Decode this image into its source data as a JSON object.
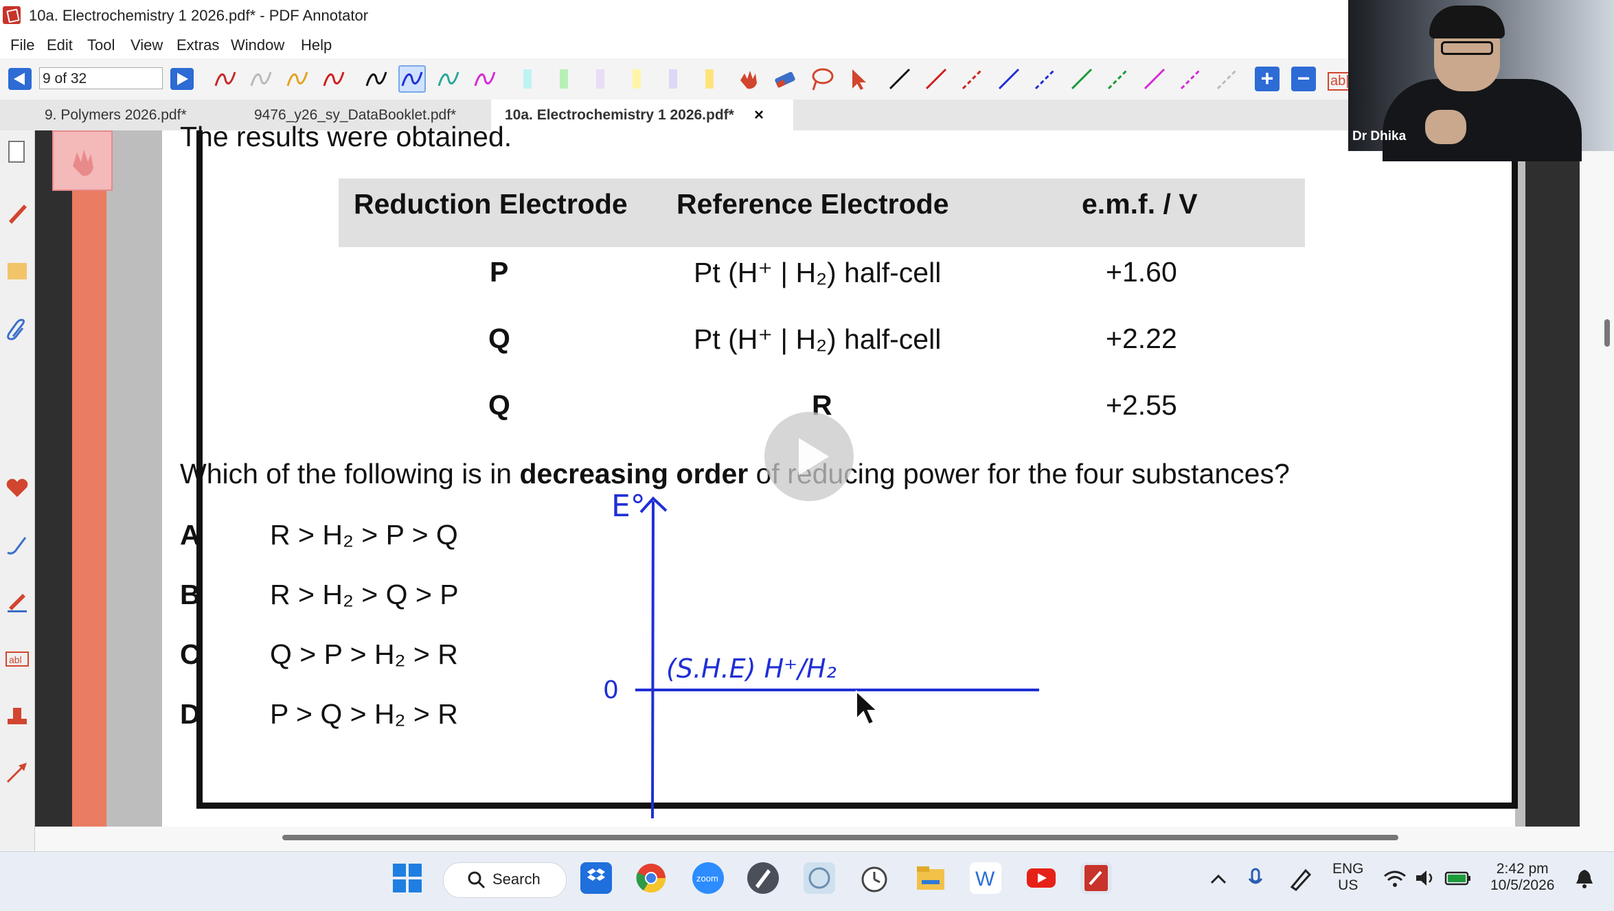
{
  "window": {
    "title": "10a. Electrochemistry 1 2026.pdf* - PDF Annotator"
  },
  "menu": [
    "File",
    "Edit",
    "Tool",
    "View",
    "Extras",
    "Window",
    "Help"
  ],
  "toolbar": {
    "page_indicator": "9 of 32",
    "text_tool_label": "ab|"
  },
  "tabs": [
    {
      "label": "9. Polymers 2026.pdf*"
    },
    {
      "label": "9476_y26_sy_DataBooklet.pdf*"
    },
    {
      "label": "10a. Electrochemistry 1 2026.pdf*",
      "active": true
    }
  ],
  "tab_close": "×",
  "document": {
    "intro": "The results were obtained.",
    "table": {
      "headers": [
        "Reduction Electrode",
        "Reference Electrode",
        "e.m.f. / V"
      ],
      "rows": [
        [
          "P",
          "Pt (H⁺ | H₂) half-cell",
          "+1.60"
        ],
        [
          "Q",
          "Pt (H⁺ | H₂) half-cell",
          "+2.22"
        ],
        [
          "Q",
          "R",
          "+2.55"
        ]
      ]
    },
    "question_pre": "Which of the following is in ",
    "question_bold": "decreasing order",
    "question_post": " of reducing power for the four substances?",
    "options": [
      {
        "letter": "A",
        "text": "R > H₂ > P > Q"
      },
      {
        "letter": "B",
        "text": "R > H₂ > Q > P"
      },
      {
        "letter": "C",
        "text": "Q > P > H₂ > R"
      },
      {
        "letter": "D",
        "text": "P > Q > H₂ > R"
      }
    ]
  },
  "annotation": {
    "y_label": "E°",
    "zero_label": "0",
    "line_label": "(S.H.E) H⁺/H₂",
    "ink_color": "#1f2fd6"
  },
  "video": {
    "participant_name": "Dr Dhika"
  },
  "taskbar": {
    "search_label": "Search",
    "language_top": "ENG",
    "language_bottom": "US",
    "time": "2:42 pm",
    "date": "10/5/2026"
  },
  "colors": {
    "accent_blue": "#2d6bd5",
    "app_red": "#c8332b",
    "ink_blue": "#1f2fd6"
  }
}
